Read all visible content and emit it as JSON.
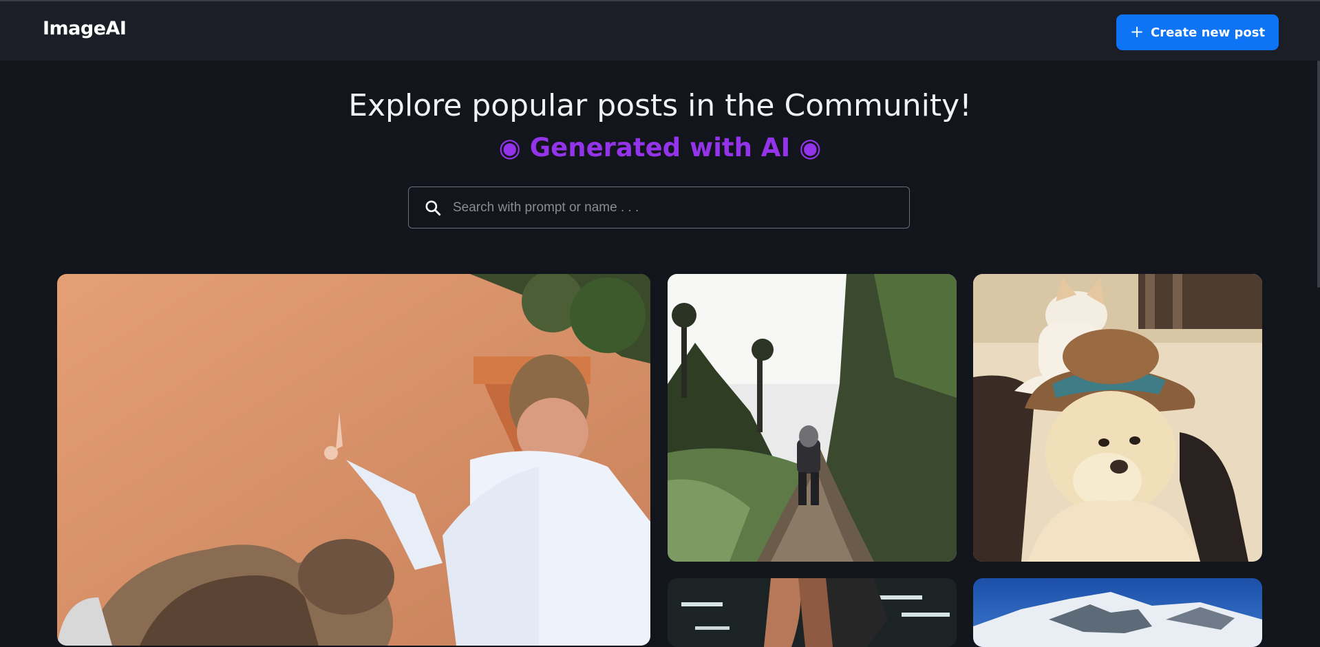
{
  "header": {
    "logo": "ImageAI",
    "create_button": {
      "icon": "+",
      "label": "Create new post"
    }
  },
  "hero": {
    "title": "Explore popular posts in the Community!",
    "subtitle": "◉ Generated with AI ◉"
  },
  "search": {
    "placeholder": "Search with prompt or name . . ."
  },
  "gallery": {
    "posts": [
      {
        "description": "boy pointing at orange wall with dog"
      },
      {
        "description": "hiker walking on forest trail"
      },
      {
        "description": "cat above dog wearing hat"
      },
      {
        "description": "person in gym"
      },
      {
        "description": "snowy mountain peak"
      }
    ]
  },
  "colors": {
    "accent": "#0d74f5",
    "subtitle": "#9333ea",
    "background": "#13151d",
    "header_bg": "#1b1e27"
  }
}
